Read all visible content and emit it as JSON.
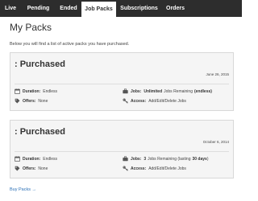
{
  "tabs": {
    "live": "Live",
    "pending": "Pending",
    "ended": "Ended",
    "job_packs": "Job Packs",
    "subscriptions": "Subscriptions",
    "orders": "Orders",
    "active": "Job Packs"
  },
  "page": {
    "title": "My Packs",
    "intro": "Below you will find a list of active packs you have purchased."
  },
  "packs": [
    {
      "title": ": Purchased",
      "date": "June 26, 2015",
      "duration_label": "Duration:",
      "duration_value": "Endless",
      "offers_label": "Offers:",
      "offers_value": "None",
      "jobs_label": "Jobs:",
      "jobs_count": "Unlimited",
      "jobs_text": "Jobs Remaining",
      "jobs_extra": "(endless)",
      "access_label": "Access:",
      "access_value": "Add/Edit/Delete Jobs"
    },
    {
      "title": ": Purchased",
      "date": "October 6, 2014",
      "duration_label": "Duration:",
      "duration_value": "Endless",
      "offers_label": "Offers:",
      "offers_value": "None",
      "jobs_label": "Jobs:",
      "jobs_count": "3",
      "jobs_text": "Jobs Remaining (lasting",
      "jobs_extra": "30 days",
      "jobs_close": ")",
      "access_label": "Access:",
      "access_value": "Add/Edit/Delete Jobs"
    }
  ],
  "footer": {
    "buy_packs": "Buy Packs →"
  },
  "colors": {
    "tab_bar": "#2d2d2d",
    "link": "#2a6fb6",
    "card_bg": "#f5f5f5"
  },
  "icons": {
    "duration": "calendar-icon",
    "offers": "tag-icon",
    "jobs": "briefcase-icon",
    "access": "key-icon"
  }
}
